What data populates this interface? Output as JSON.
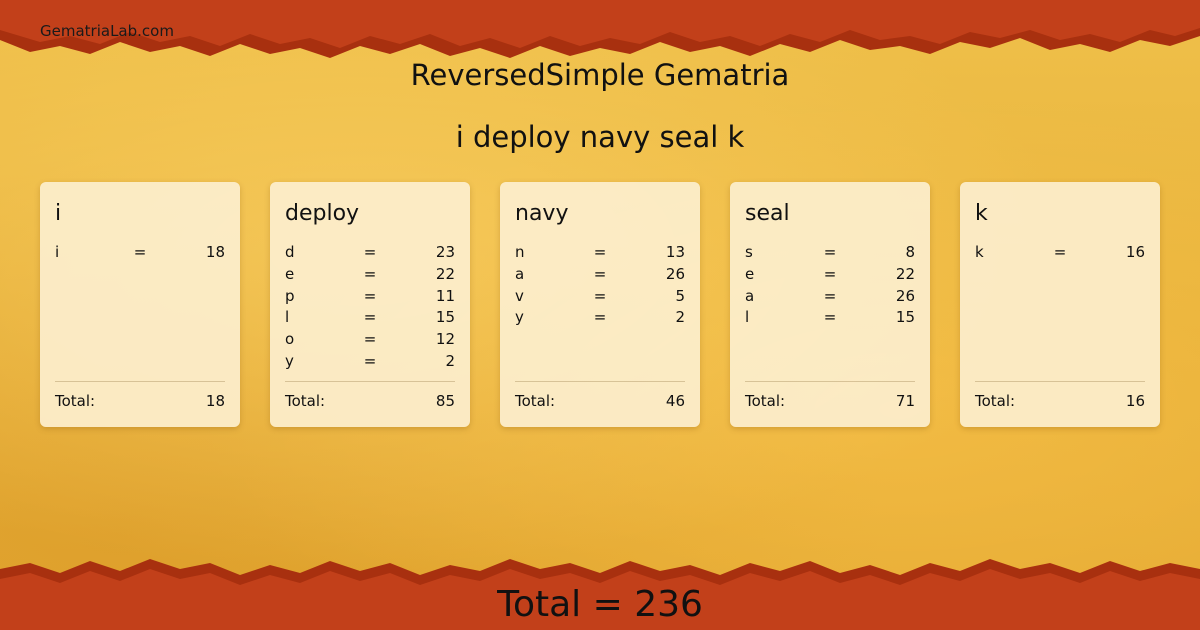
{
  "site_name": "GematriaLab.com",
  "title": "ReversedSimple Gematria",
  "phrase": "i deploy navy seal k",
  "equals_sign": "=",
  "total_label": "Total:",
  "words": [
    {
      "word": "i",
      "letters": [
        {
          "letter": "i",
          "value": "18"
        }
      ],
      "total": "18"
    },
    {
      "word": "deploy",
      "letters": [
        {
          "letter": "d",
          "value": "23"
        },
        {
          "letter": "e",
          "value": "22"
        },
        {
          "letter": "p",
          "value": "11"
        },
        {
          "letter": "l",
          "value": "15"
        },
        {
          "letter": "o",
          "value": "12"
        },
        {
          "letter": "y",
          "value": "2"
        }
      ],
      "total": "85"
    },
    {
      "word": "navy",
      "letters": [
        {
          "letter": "n",
          "value": "13"
        },
        {
          "letter": "a",
          "value": "26"
        },
        {
          "letter": "v",
          "value": "5"
        },
        {
          "letter": "y",
          "value": "2"
        }
      ],
      "total": "46"
    },
    {
      "word": "seal",
      "letters": [
        {
          "letter": "s",
          "value": "8"
        },
        {
          "letter": "e",
          "value": "22"
        },
        {
          "letter": "a",
          "value": "26"
        },
        {
          "letter": "l",
          "value": "15"
        }
      ],
      "total": "71"
    },
    {
      "word": "k",
      "letters": [
        {
          "letter": "k",
          "value": "16"
        }
      ],
      "total": "16"
    }
  ],
  "grand_total": "Total  = 236",
  "colors": {
    "band_red": "#c2401a",
    "band_dark": "#a8300f",
    "background_gold": "#eab73a",
    "card": "#fcefd0"
  }
}
